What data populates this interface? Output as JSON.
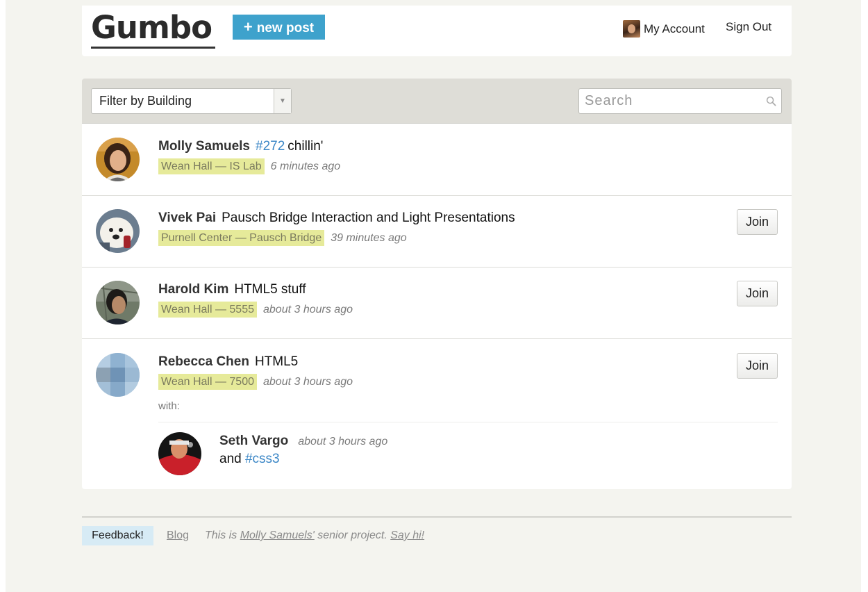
{
  "header": {
    "logo": "Gumbo",
    "new_post_plus": "+",
    "new_post_label": "new post",
    "my_account": "My Account",
    "sign_out": "Sign Out"
  },
  "toolbar": {
    "filter_label": "Filter by Building",
    "filter_arrow": "▼",
    "search_placeholder": "Search"
  },
  "feed": {
    "items": [
      {
        "user": "Molly Samuels",
        "tag": "#272",
        "title": "chillin'",
        "location": "Wean Hall — IS Lab",
        "time": "6 minutes ago"
      },
      {
        "user": "Vivek Pai",
        "title": "Pausch Bridge Interaction and Light Presentations",
        "location": "Purnell Center — Pausch Bridge",
        "time": "39 minutes ago",
        "join_label": "Join"
      },
      {
        "user": "Harold Kim",
        "title": "HTML5 stuff",
        "location": "Wean Hall — 5555",
        "time": "about 3 hours ago",
        "join_label": "Join"
      },
      {
        "user": "Rebecca Chen",
        "title": "HTML5",
        "location": "Wean Hall — 7500",
        "time": "about 3 hours ago",
        "join_label": "Join",
        "with_label": "with:",
        "participants": [
          {
            "user": "Seth Vargo",
            "time": "about 3 hours ago",
            "message_prefix": "and",
            "tag": "#css3"
          }
        ]
      }
    ]
  },
  "footer": {
    "feedback_label": "Feedback!",
    "blog_label": "Blog",
    "credit_prefix": "This is",
    "credit_link": "Molly Samuels'",
    "credit_middle": "senior project.",
    "credit_cta": "Say hi!"
  },
  "colors": {
    "accent": "#3ea2cc",
    "tag": "#3a86c6",
    "location_highlight": "#e6ea9a",
    "feedback_bg": "#d7ebf5",
    "page_bg": "#f4f4ef"
  }
}
